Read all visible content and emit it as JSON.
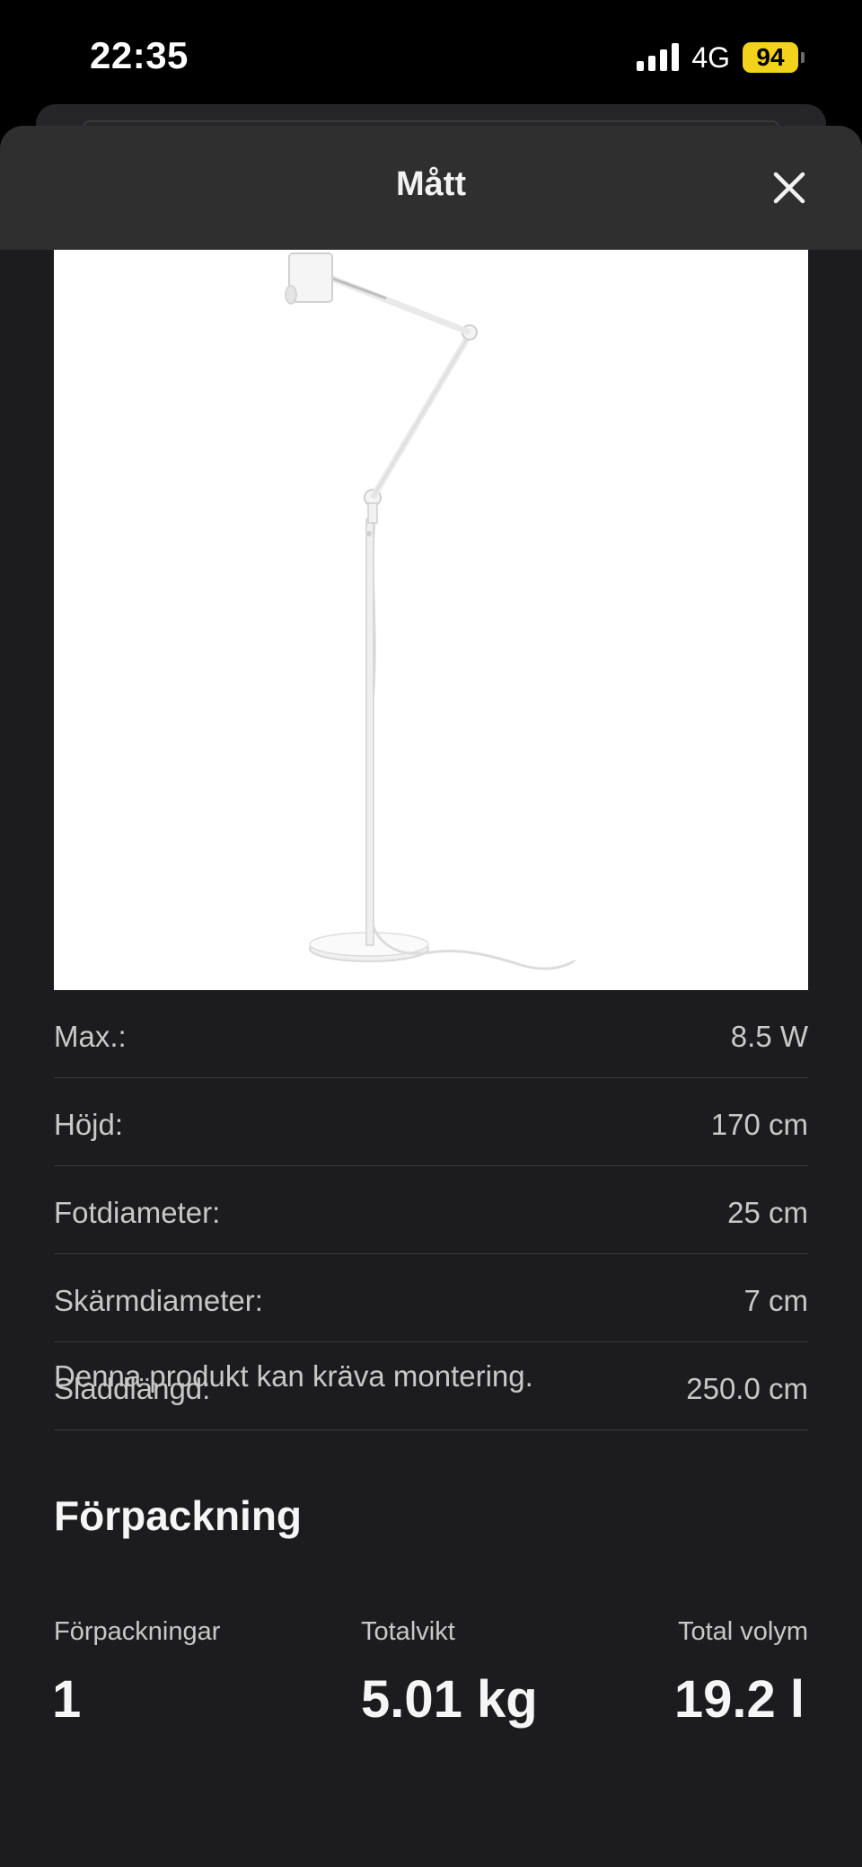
{
  "status_bar": {
    "time": "22:35",
    "network": "4G",
    "battery": "94",
    "battery_color": "#f2d21b"
  },
  "sheet": {
    "title": "Mått",
    "close_icon": "close-icon"
  },
  "specs": [
    {
      "label": "Max.:",
      "value": "8.5 W"
    },
    {
      "label": "Höjd:",
      "value": "170 cm"
    },
    {
      "label": "Fotdiameter:",
      "value": "25 cm"
    },
    {
      "label": "Skärmdiameter:",
      "value": "7 cm"
    },
    {
      "label": "Sladdlängd:",
      "value": "250.0 cm"
    }
  ],
  "assembly_note": "Denna produkt kan kräva montering.",
  "packaging": {
    "title": "Förpackning",
    "count_label": "Förpackningar",
    "count_value": "1",
    "weight_label": "Totalvikt",
    "weight_value": "5.01 kg",
    "volume_label": "Total volym",
    "volume_value": "19.2 l"
  }
}
